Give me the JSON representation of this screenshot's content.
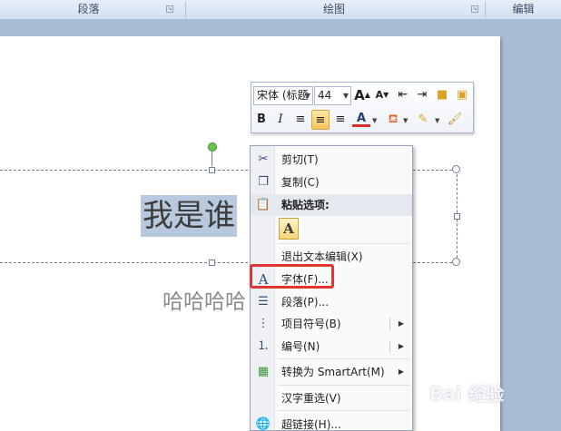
{
  "ribbon": {
    "groups": [
      {
        "label": "段落"
      },
      {
        "label": "绘图"
      },
      {
        "label": "编辑"
      }
    ]
  },
  "slide": {
    "title": "我是谁",
    "subtitle": "哈哈哈哈"
  },
  "mini_toolbar": {
    "font_name": "宋体 (标题",
    "font_size": "44",
    "grow_font_icon": "A",
    "shrink_font_icon": "A",
    "bold": "B",
    "italic": "I",
    "font_color_icon": "A"
  },
  "context_menu": {
    "items": [
      {
        "label": "剪切(T)",
        "icon": "scissors-icon"
      },
      {
        "label": "复制(C)",
        "icon": "copy-icon"
      },
      {
        "label": "粘贴选项:",
        "icon": "clipboard-icon"
      },
      {
        "label": "退出文本编辑(X)"
      },
      {
        "label": "字体(F)...",
        "icon": "font-icon"
      },
      {
        "label": "段落(P)...",
        "icon": "paragraph-icon"
      },
      {
        "label": "项目符号(B)",
        "icon": "bullets-icon"
      },
      {
        "label": "编号(N)",
        "icon": "numbering-icon"
      },
      {
        "label": "转换为 SmartArt(M)",
        "icon": "smartart-icon"
      },
      {
        "label": "汉字重选(V)"
      },
      {
        "label": "超链接(H)...",
        "icon": "hyperlink-icon"
      }
    ],
    "paste_option": "A"
  },
  "watermark": "Bai 经验"
}
